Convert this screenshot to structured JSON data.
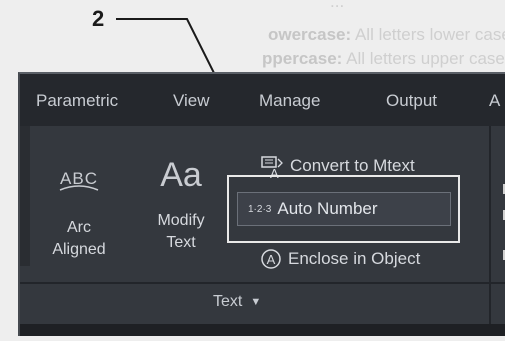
{
  "background_text": {
    "line1": "...",
    "line2_bold": "owercase:",
    "line2_rest": " All letters lower case",
    "line3_bold": "ppercase:",
    "line3_rest": " All letters upper case"
  },
  "callout": {
    "number": "2"
  },
  "ribbon": {
    "tabs": [
      "Parametric",
      "View",
      "Manage",
      "Output",
      "A"
    ],
    "panel": {
      "title": "Text",
      "arc_aligned": {
        "icon_text": "ABC",
        "label_line1": "Arc",
        "label_line2": "Aligned"
      },
      "modify_text": {
        "icon_text": "Aa",
        "label_line1": "Modify",
        "label_line2": "Text"
      },
      "convert_to_mtext": {
        "label": "Convert to Mtext",
        "icon_letter": "A"
      },
      "auto_number": {
        "label": "Auto Number",
        "icon_text": "1·2·3"
      },
      "enclose_in_object": {
        "label": "Enclose in Object",
        "icon_letter": "A"
      }
    }
  },
  "colors": {
    "ribbon_bg": "#34383e",
    "tabbar_bg": "#25282d",
    "text": "#d6d9de",
    "highlight": "#e9e9e9"
  }
}
